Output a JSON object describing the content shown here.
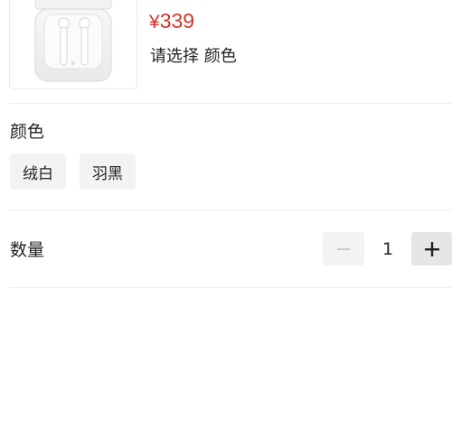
{
  "product": {
    "currency": "¥",
    "price": "339",
    "select_hint": "请选择 颜色"
  },
  "color_section": {
    "title": "颜色",
    "options": [
      "绒白",
      "羽黑"
    ]
  },
  "quantity_section": {
    "title": "数量",
    "value": "1",
    "minus_enabled": false,
    "plus_enabled": true
  },
  "colors": {
    "price_red": "#d6332b",
    "chip_bg": "#f3f3f3"
  }
}
